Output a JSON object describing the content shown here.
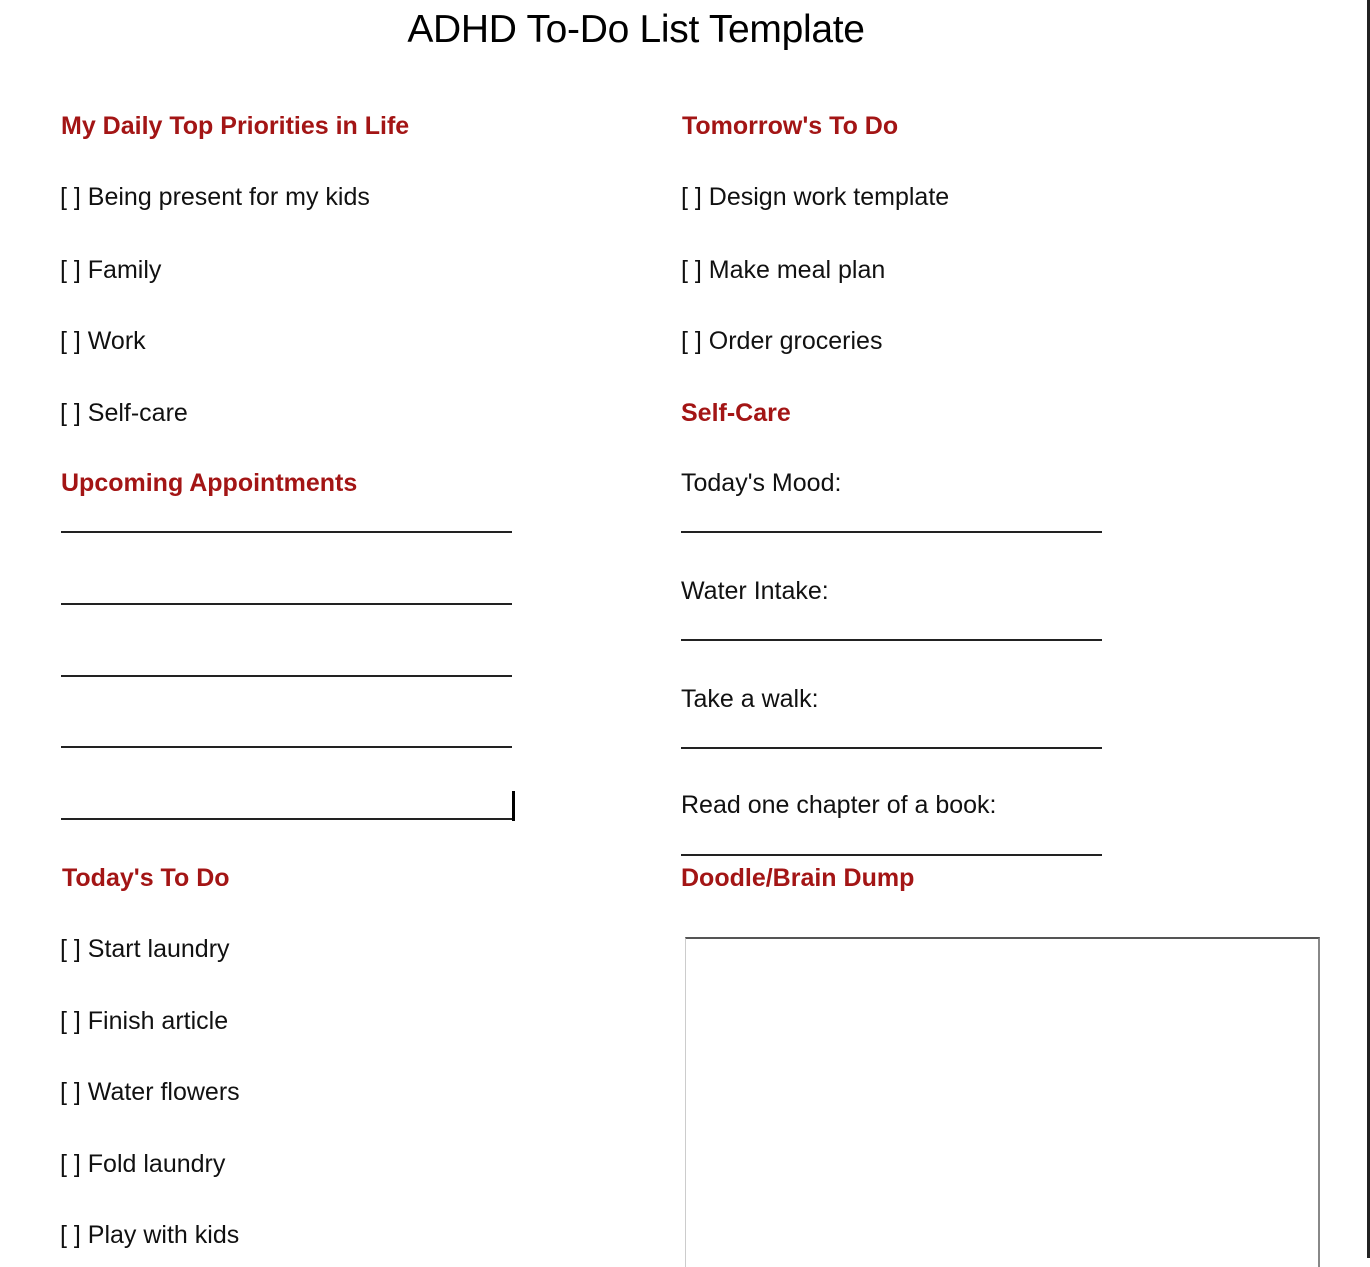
{
  "title": "ADHD To-Do List Template",
  "left": {
    "priorities": {
      "heading": "My Daily Top Priorities in Life",
      "items": [
        "[ ] Being present for my kids",
        "[ ] Family",
        "[ ] Work",
        "[ ] Self-care"
      ]
    },
    "appointments": {
      "heading": "Upcoming Appointments",
      "blank_lines": 5
    },
    "today": {
      "heading": "Today's To Do",
      "items": [
        "[ ] Start laundry",
        "[ ] Finish article",
        "[ ] Water flowers",
        "[ ] Fold laundry",
        "[ ] Play with kids"
      ]
    }
  },
  "right": {
    "tomorrow": {
      "heading": "Tomorrow's To Do",
      "items": [
        "[ ] Design work template",
        "[ ] Make meal plan",
        "[ ] Order groceries"
      ]
    },
    "selfcare": {
      "heading": "Self-Care",
      "fields": [
        {
          "label": "Today's Mood:"
        },
        {
          "label": "Water Intake:"
        },
        {
          "label": "Take a walk:"
        },
        {
          "label": "Read one chapter of a book:"
        }
      ]
    },
    "doodle": {
      "heading": "Doodle/Brain Dump"
    }
  }
}
